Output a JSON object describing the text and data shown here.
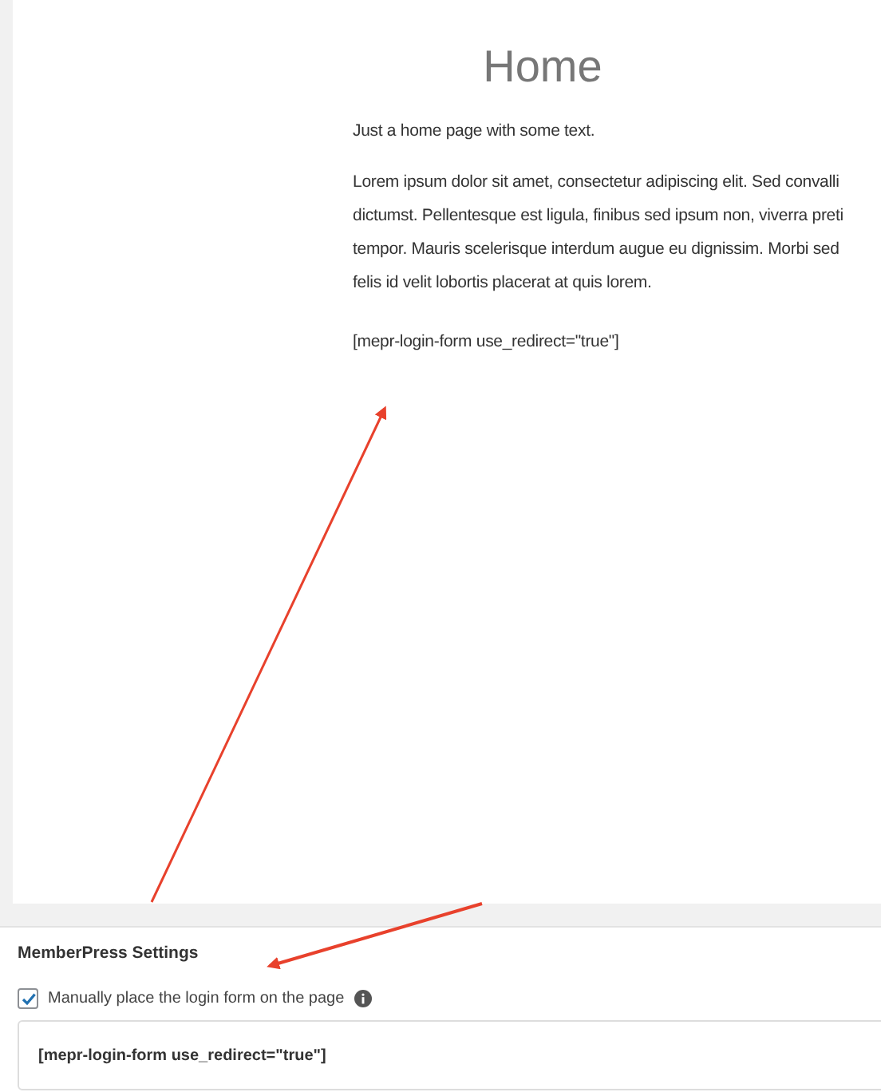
{
  "editor": {
    "title": "Home",
    "intro": "Just a home page with some text.",
    "paragraph_lines": [
      "Lorem ipsum dolor sit amet, consectetur adipiscing elit. Sed convalli",
      "dictumst. Pellentesque est ligula, finibus sed ipsum non, viverra preti",
      "tempor. Mauris scelerisque interdum augue eu dignissim. Morbi sed",
      "felis id velit lobortis placerat at quis lorem."
    ],
    "shortcode": "[mepr-login-form use_redirect=\"true\"]"
  },
  "settings": {
    "title": "MemberPress Settings",
    "manual_checkbox": {
      "label": "Manually place the login form on the page",
      "checked": true
    },
    "shortcode_box": "[mepr-login-form use_redirect=\"true\"]"
  }
}
